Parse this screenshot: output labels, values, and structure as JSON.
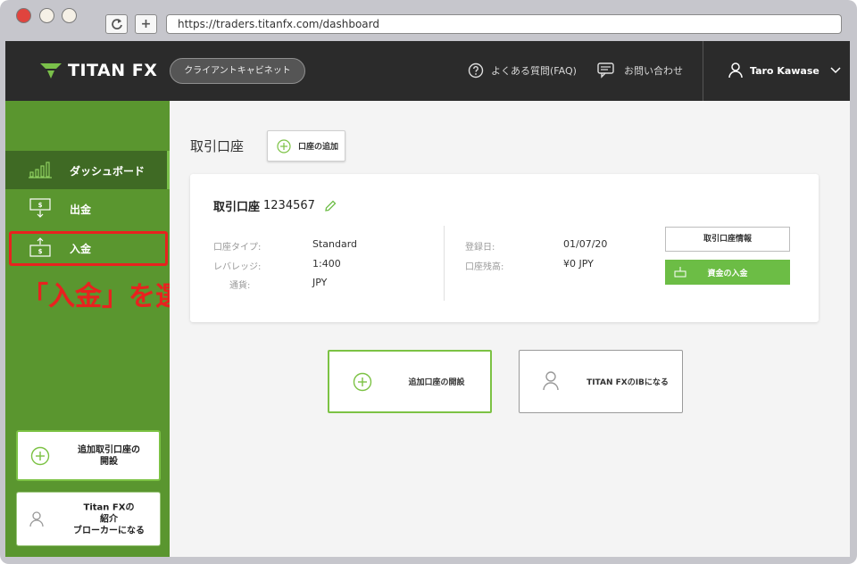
{
  "browser": {
    "url": "https://traders.titanfx.com/dashboard",
    "plus_label": "+"
  },
  "header": {
    "logo_text": "TITAN FX",
    "cabinet_label": "クライアントキャビネット",
    "faq_label": "よくある質問(FAQ)",
    "contact_label": "お問い合わせ",
    "user_name": "Taro Kawase"
  },
  "sidebar": {
    "items": [
      {
        "label": "ダッシュボード",
        "icon": "bar-chart-icon"
      },
      {
        "label": "出金",
        "icon": "withdraw-icon"
      },
      {
        "label": "入金",
        "icon": "deposit-icon"
      }
    ],
    "annotation": "「入金」を選択",
    "open_account_label": "追加取引口座の開設",
    "referral_label": "Titan FXの紹介ブローカーになる",
    "referral_lines": [
      "Titan FXの",
      "紹介",
      "ブローカーになる"
    ],
    "open_account_lines": [
      "追加取引口座の",
      "開設"
    ]
  },
  "main": {
    "title": "取引口座",
    "add_account_label": "口座の追加",
    "account": {
      "title": "取引口座",
      "number": "1234567",
      "fields_left": [
        {
          "label": "口座タイプ:",
          "value": "Standard"
        },
        {
          "label": "レバレッジ:",
          "value": "1:400"
        },
        {
          "label": "通貨:",
          "value": "JPY"
        }
      ],
      "fields_right": [
        {
          "label": "登録日:",
          "value": "01/07/20"
        },
        {
          "label": "口座残高:",
          "value": "¥0 JPY"
        }
      ],
      "info_button": "取引口座情報",
      "deposit_button": "資金の入金"
    },
    "open_additional_label": "追加口座の開設",
    "become_ib_label": "TITAN FXのIBになる"
  },
  "colors": {
    "header_bg": "#2b2b2b",
    "sidebar_bg": "#5a962f",
    "accent_green": "#6cbd45",
    "annotation_red": "#e8221f"
  }
}
